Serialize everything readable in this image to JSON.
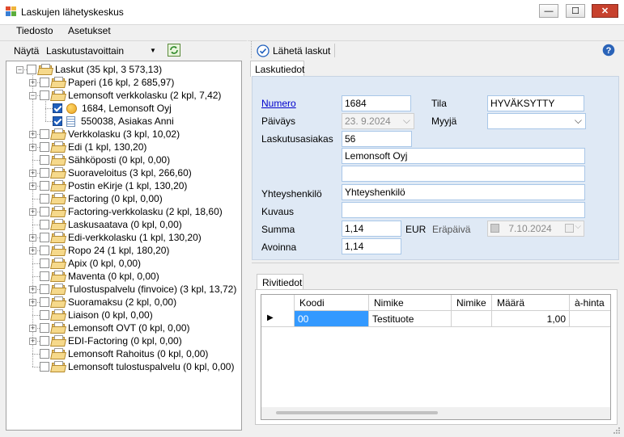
{
  "window": {
    "title": "Laskujen lähetyskeskus",
    "minimize": "—",
    "maximize": "☐",
    "close": "✕"
  },
  "menu": [
    "Tiedosto",
    "Asetukset"
  ],
  "left_toolbar": {
    "show_label": "Näytä",
    "selected": "Laskutustavoittain"
  },
  "tree": [
    {
      "label": "Laskut (35 kpl, 3 573,13)",
      "level": 0,
      "expander": "minus",
      "checked": false,
      "icon": "folder"
    },
    {
      "label": "Paperi (16 kpl, 2 685,97)",
      "level": 1,
      "expander": "plus",
      "checked": false,
      "icon": "folder"
    },
    {
      "label": "Lemonsoft verkkolasku (2 kpl, 7,42)",
      "level": 1,
      "expander": "minus",
      "checked": false,
      "icon": "folder"
    },
    {
      "label": "1684, Lemonsoft Oyj",
      "level": 2,
      "expander": "",
      "checked": true,
      "icon": "status-dot"
    },
    {
      "label": "550038, Asiakas Anni",
      "level": 2,
      "expander": "",
      "checked": true,
      "icon": "document"
    },
    {
      "label": "Verkkolasku (3 kpl, 10,02)",
      "level": 1,
      "expander": "plus",
      "checked": false,
      "icon": "folder"
    },
    {
      "label": "Edi (1 kpl, 130,20)",
      "level": 1,
      "expander": "plus",
      "checked": false,
      "icon": "folder"
    },
    {
      "label": "Sähköposti (0 kpl, 0,00)",
      "level": 1,
      "expander": "",
      "checked": false,
      "icon": "folder"
    },
    {
      "label": "Suoraveloitus (3 kpl, 266,60)",
      "level": 1,
      "expander": "plus",
      "checked": false,
      "icon": "folder"
    },
    {
      "label": "Postin eKirje (1 kpl, 130,20)",
      "level": 1,
      "expander": "plus",
      "checked": false,
      "icon": "folder"
    },
    {
      "label": "Factoring (0 kpl, 0,00)",
      "level": 1,
      "expander": "",
      "checked": false,
      "icon": "folder"
    },
    {
      "label": "Factoring-verkkolasku (2 kpl, 18,60)",
      "level": 1,
      "expander": "plus",
      "checked": false,
      "icon": "folder"
    },
    {
      "label": "Laskusaatava (0 kpl, 0,00)",
      "level": 1,
      "expander": "",
      "checked": false,
      "icon": "folder"
    },
    {
      "label": "Edi-verkkolasku (1 kpl, 130,20)",
      "level": 1,
      "expander": "plus",
      "checked": false,
      "icon": "folder"
    },
    {
      "label": "Ropo 24 (1 kpl, 180,20)",
      "level": 1,
      "expander": "plus",
      "checked": false,
      "icon": "folder"
    },
    {
      "label": "Apix (0 kpl, 0,00)",
      "level": 1,
      "expander": "",
      "checked": false,
      "icon": "folder"
    },
    {
      "label": "Maventa (0 kpl, 0,00)",
      "level": 1,
      "expander": "",
      "checked": false,
      "icon": "folder"
    },
    {
      "label": "Tulostuspalvelu (finvoice) (3 kpl, 13,72)",
      "level": 1,
      "expander": "plus",
      "checked": false,
      "icon": "folder"
    },
    {
      "label": "Suoramaksu (2 kpl, 0,00)",
      "level": 1,
      "expander": "plus",
      "checked": false,
      "icon": "folder"
    },
    {
      "label": "Liaison (0 kpl, 0,00)",
      "level": 1,
      "expander": "",
      "checked": false,
      "icon": "folder"
    },
    {
      "label": "Lemonsoft OVT (0 kpl, 0,00)",
      "level": 1,
      "expander": "plus",
      "checked": false,
      "icon": "folder"
    },
    {
      "label": "EDI-Factoring (0 kpl, 0,00)",
      "level": 1,
      "expander": "plus",
      "checked": false,
      "icon": "folder"
    },
    {
      "label": "Lemonsoft Rahoitus (0 kpl, 0,00)",
      "level": 1,
      "expander": "",
      "checked": false,
      "icon": "folder"
    },
    {
      "label": "Lemonsoft tulostuspalvelu (0 kpl, 0,00)",
      "level": 1,
      "expander": "",
      "checked": false,
      "icon": "folder"
    }
  ],
  "right_toolbar": {
    "send_label": "Lähetä laskut"
  },
  "invoice": {
    "tab_label": "Laskutiedot",
    "numero_label": "Numero",
    "numero": "1684",
    "tila_label": "Tila",
    "tila": "HYVÄKSYTTY",
    "paivays_label": "Päiväys",
    "paivays": "23. 9.2024",
    "myyja_label": "Myyjä",
    "myyja": "",
    "laskutusasiakas_label": "Laskutusasiakas",
    "asiakas_nro": "56",
    "asiakas_nimi": "Lemonsoft Oyj",
    "asiakas_rivi2": "",
    "yhteyshenkilo_label": "Yhteyshenkilö",
    "yhteyshenkilo": "Yhteyshenkilö",
    "kuvaus_label": "Kuvaus",
    "kuvaus": "",
    "summa_label": "Summa",
    "summa": "1,14",
    "valuutta": "EUR",
    "erapaiva_label": "Eräpäivä",
    "erapaiva": "7.10.2024",
    "avoinna_label": "Avoinna",
    "avoinna": "1,14"
  },
  "rows": {
    "tab_label": "Rivitiedot",
    "headers": [
      "Koodi",
      "Nimike",
      "Nimike",
      "Määrä",
      "à-hinta"
    ],
    "data": [
      {
        "koodi": "00",
        "nimike": "Testituote",
        "nimike2": "",
        "maara": "1,00",
        "hinta": ""
      }
    ]
  },
  "colors": {
    "accent": "#3399ff",
    "link": "#0000cc",
    "panel_bg": "#dfe9f5",
    "selected_cell": "#3399ff"
  }
}
